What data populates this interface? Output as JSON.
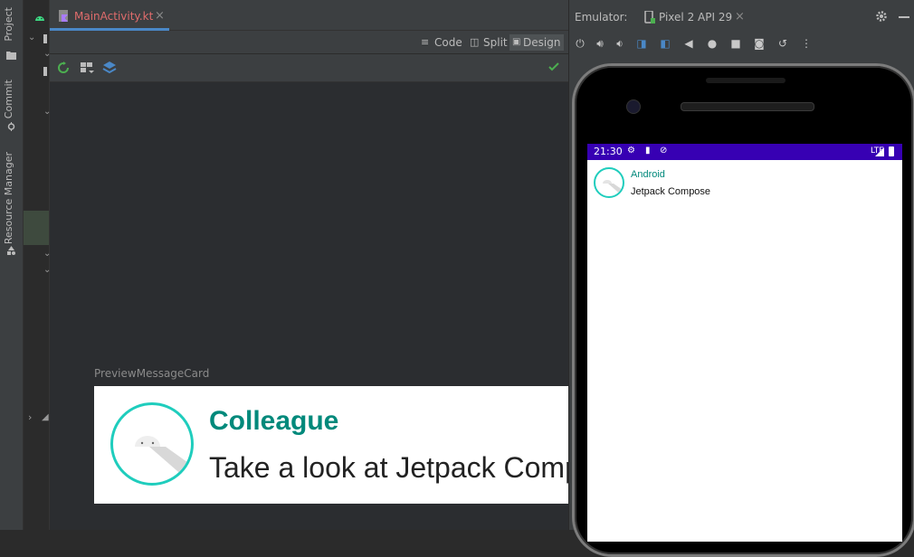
{
  "tool_strip": {
    "tabs": [
      {
        "label": "Project",
        "icon": "folder-icon"
      },
      {
        "label": "Commit",
        "icon": "commit-icon"
      },
      {
        "label": "Resource Manager",
        "icon": "resource-manager-icon"
      }
    ]
  },
  "editor": {
    "tab": {
      "label": "MainActivity.kt",
      "close": "×",
      "icon": "kotlin-file-icon"
    },
    "modes": [
      {
        "label": "Code",
        "icon": "code-lines-icon"
      },
      {
        "label": "Split",
        "icon": "split-icon"
      },
      {
        "label": "Design",
        "icon": "image-icon"
      }
    ],
    "design_toolbar_icons": [
      "refresh-icon",
      "device-icon",
      "layers-icon",
      "check-icon"
    ],
    "preview": {
      "label": "PreviewMessageCard",
      "card_author": "Colleague",
      "card_body": "Take a look at Jetpack Compose, it's great!"
    }
  },
  "emulator": {
    "label": "Emulator:",
    "device_tab": "Pixel 2 API 29",
    "close": "×",
    "toolbar_icons": [
      "power-icon",
      "volume-up-icon",
      "volume-down-icon",
      "rotate-left-icon",
      "rotate-right-icon",
      "back-icon",
      "home-icon",
      "overview-icon",
      "screenshot-icon",
      "snapshot-icon",
      "more-icon"
    ],
    "status_time": "21:30",
    "status_net": "LTE",
    "app_author": "Android",
    "app_body": "Jetpack Compose"
  },
  "colors": {
    "accent_teal": "#00897b",
    "avatar_ring": "#1fcdbd",
    "status_bar": "#3700b3",
    "tab_underline": "#4a88c7"
  }
}
